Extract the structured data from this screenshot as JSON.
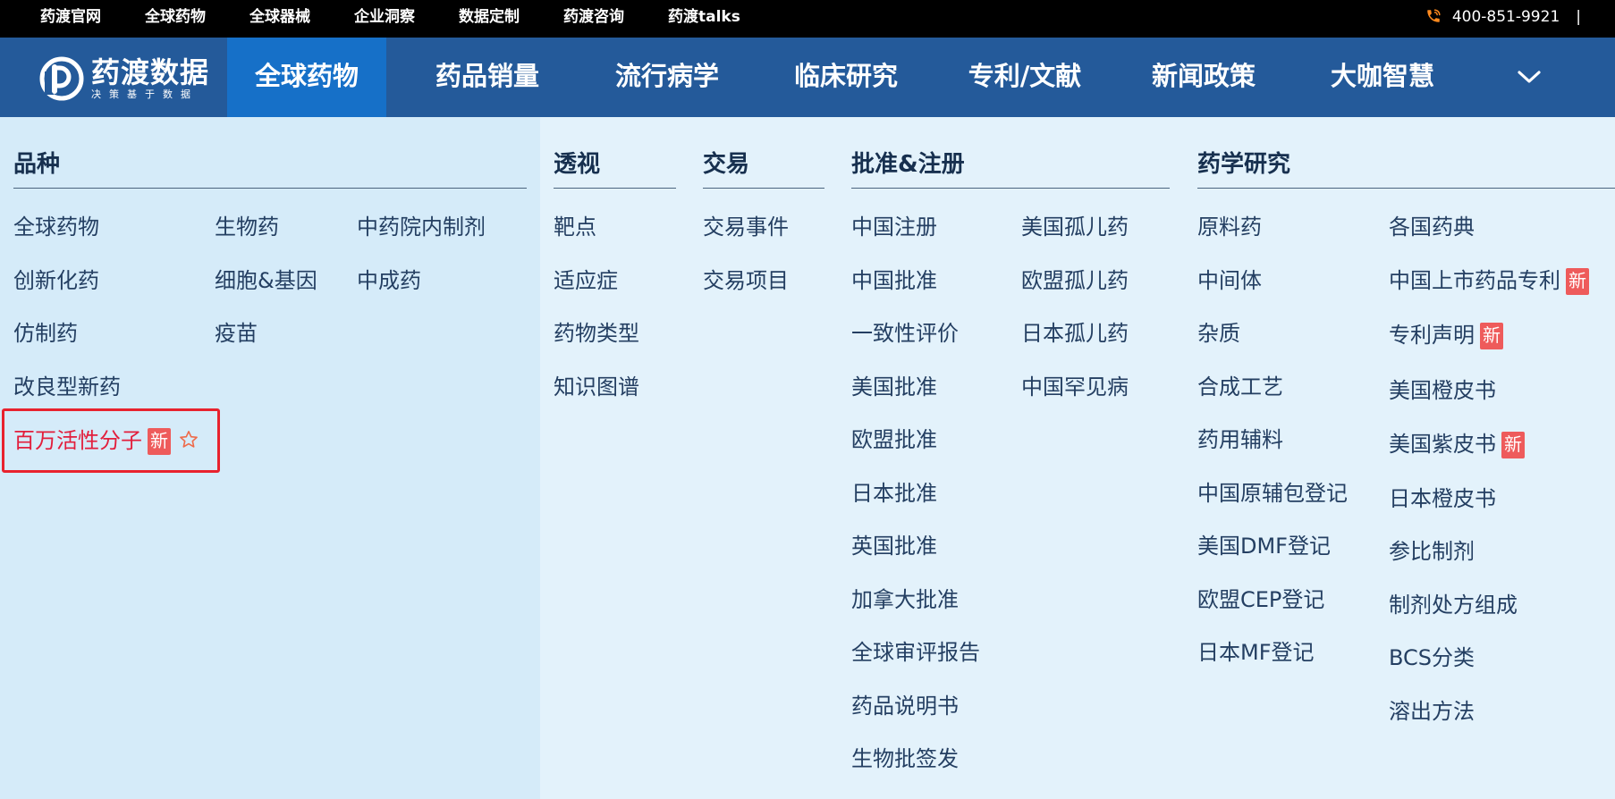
{
  "topbar": {
    "links": [
      "药渡官网",
      "全球药物",
      "全球器械",
      "企业洞察",
      "数据定制",
      "药渡咨询",
      "药渡talks"
    ],
    "phone": "400-851-9921",
    "separator": "|",
    "phone_icon": "phone-icon"
  },
  "logo": {
    "name": "药渡数据",
    "slogan": "决策基于数据"
  },
  "nav": {
    "items": [
      "全球药物",
      "药品销量",
      "流行病学",
      "临床研究",
      "专利/文献",
      "新闻政策",
      "大咖智慧"
    ],
    "active": "全球药物",
    "more_icon": "chevron-down-icon"
  },
  "colors": {
    "topbar_bg": "#000000",
    "nav_bg": "#245a9a",
    "nav_active_bg": "#1670c8",
    "panel_left_bg": "#d5ebf9",
    "panel_right_bg": "#e3f2fb",
    "highlight": "#e21e3c",
    "badge_bg": "#ee5b5b"
  },
  "badge_new": "新",
  "sections": {
    "varieties": {
      "title": "品种",
      "col1": [
        "全球药物",
        "创新化药",
        "仿制药",
        "改良型新药"
      ],
      "col2": [
        "生物药",
        "细胞&基因",
        "疫苗"
      ],
      "col3": [
        "中药院内制剂",
        "中成药"
      ],
      "highlighted_item": "百万活性分子"
    },
    "perspective": {
      "title": "透视",
      "items": [
        "靶点",
        "适应症",
        "药物类型",
        "知识图谱"
      ]
    },
    "trade": {
      "title": "交易",
      "items": [
        "交易事件",
        "交易项目"
      ]
    },
    "approval": {
      "title": "批准&注册",
      "col1": [
        "中国注册",
        "中国批准",
        "一致性评价",
        "美国批准",
        "欧盟批准",
        "日本批准",
        "英国批准",
        "加拿大批准",
        "全球审评报告",
        "药品说明书",
        "生物批签发"
      ],
      "col2": [
        "美国孤儿药",
        "欧盟孤儿药",
        "日本孤儿药",
        "中国罕见病"
      ]
    },
    "pharma": {
      "title": "药学研究",
      "col1": [
        "原料药",
        "中间体",
        "杂质",
        "合成工艺",
        "药用辅料",
        "中国原辅包登记",
        "美国DMF登记",
        "欧盟CEP登记",
        "日本MF登记"
      ],
      "col2": [
        "各国药典",
        "中国上市药品专利",
        "专利声明",
        "美国橙皮书",
        "美国紫皮书",
        "日本橙皮书",
        "参比制剂",
        "制剂处方组成",
        "BCS分类",
        "溶出方法"
      ]
    }
  }
}
